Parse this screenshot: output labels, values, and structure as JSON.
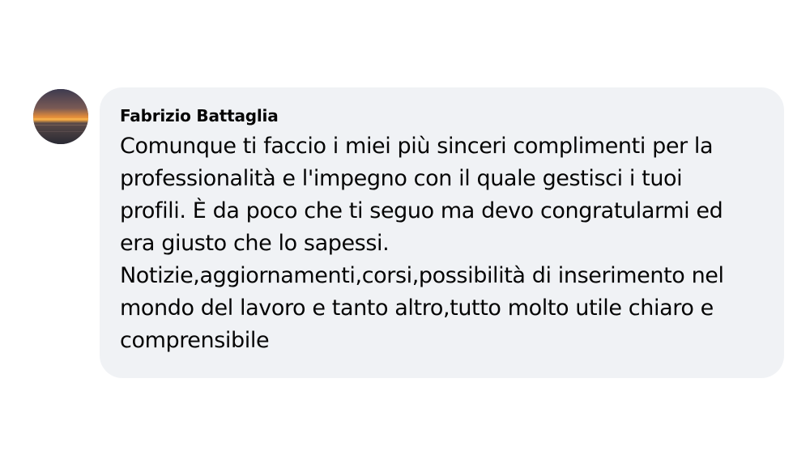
{
  "comment": {
    "author": "Fabrizio Battaglia",
    "avatar_icon": "sunset-over-sea-avatar",
    "bubble_color": "#f0f2f5",
    "lines": [
      "Comunque ti faccio i miei più sinceri complimenti per la",
      "professionalità e l'impegno con il quale gestisci i tuoi",
      "profili. È da poco che ti seguo ma devo congratularmi ed",
      "era giusto che lo sapessi.",
      "Notizie,aggiornamenti,corsi,possibilità di inserimento nel",
      "mondo del lavoro e tanto altro,tutto molto utile chiaro e",
      "comprensibile"
    ]
  }
}
